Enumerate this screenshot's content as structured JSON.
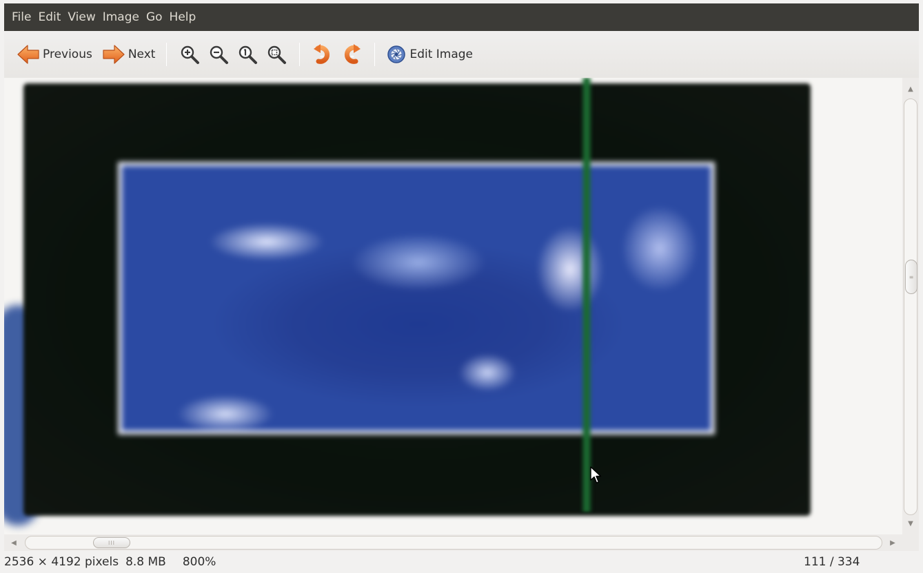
{
  "menubar": {
    "items": [
      "File",
      "Edit",
      "View",
      "Image",
      "Go",
      "Help"
    ]
  },
  "toolbar": {
    "previous_label": "Previous",
    "next_label": "Next",
    "edit_image_label": "Edit Image",
    "icons": {
      "previous": "arrow-left-icon",
      "next": "arrow-right-icon",
      "zoom_in": "zoom-in-icon",
      "zoom_out": "zoom-out-icon",
      "zoom_normal": "zoom-100-icon",
      "zoom_fit": "zoom-fit-icon",
      "rotate_left": "rotate-left-icon",
      "rotate_right": "rotate-right-icon",
      "edit_image": "shutter-icon"
    }
  },
  "statusbar": {
    "dimensions": "2536 × 4192 pixels",
    "file_size": "8.8 MB",
    "zoom": "800%",
    "position": "111 / 334"
  },
  "colors": {
    "menubar_bg": "#3c3b37",
    "arrow_orange": "#f07a2a",
    "rotate_orange": "#e8742c",
    "image_blue": "#2a469f",
    "image_frame": "#0d170f"
  }
}
